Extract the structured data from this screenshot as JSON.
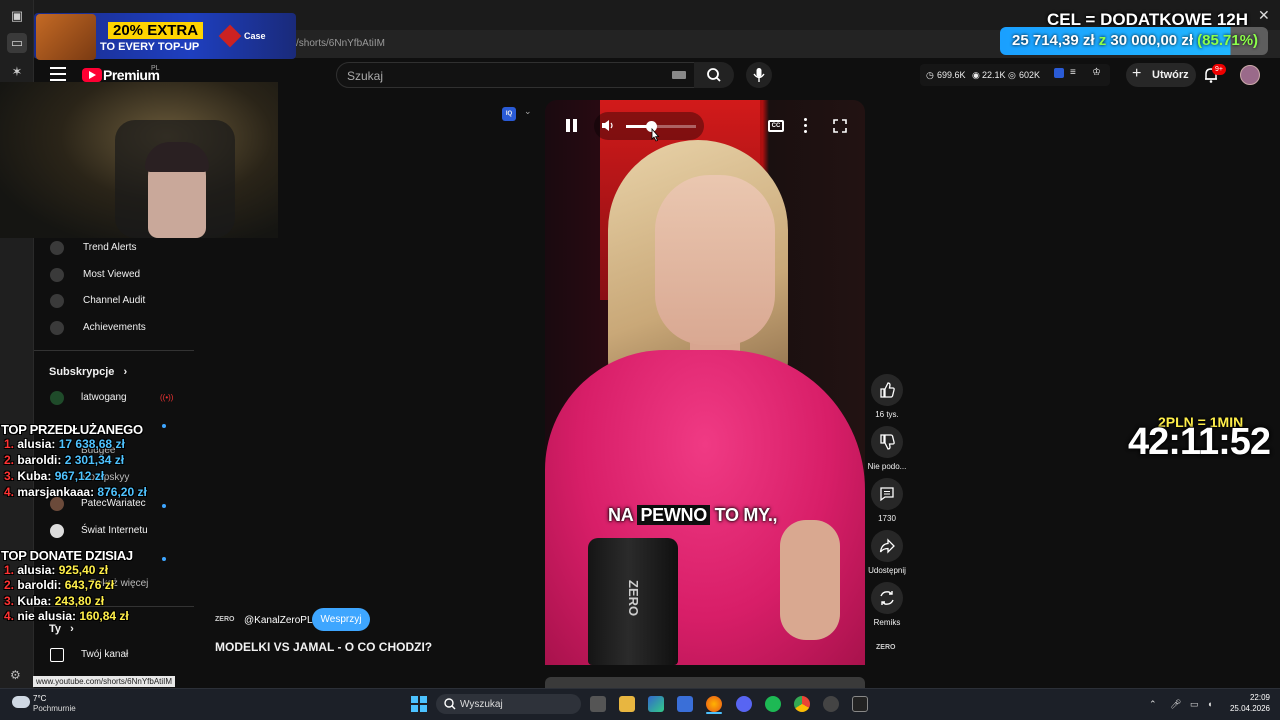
{
  "browser": {
    "url": "/shorts/6NnYfbAtiIM",
    "status_url": "www.youtube.com/shorts/6NnYfbAtiIM"
  },
  "youtube": {
    "brand": "Premium",
    "brand_region": "PL",
    "search_placeholder": "Szukaj",
    "stats": {
      "views": "699.6K",
      "likes": "22.1K",
      "subs": "602K"
    },
    "create_label": "Utwórz",
    "notif_badge": "9+"
  },
  "sidebar": {
    "tools": [
      {
        "label": "Trend Alerts"
      },
      {
        "label": "Most Viewed"
      },
      {
        "label": "Channel Audit"
      },
      {
        "label": "Achievements"
      }
    ],
    "subs_heading": "Subskrypcje",
    "subs_chevron": "›",
    "subscriptions": [
      {
        "label": "latwogang"
      },
      {
        "label": "Budgee"
      },
      {
        "label": "Morbpskyy"
      },
      {
        "label": "PatecWariatec"
      },
      {
        "label": "Świat Internetu"
      },
      {
        "label": "Pokaż więcej"
      }
    ],
    "you_heading": "Ty",
    "you_chevron": "›",
    "your_channel": "Twój kanał"
  },
  "promo": {
    "line1": "20% EXTRA",
    "line2": "TO EVERY TOP-UP",
    "brand": "Case"
  },
  "goal": {
    "title": "CEL = DODATKOWE 12H",
    "current": "25 714,39 zł",
    "sep": "z",
    "target": "30 000,00 zł",
    "percent": "(85.71%)",
    "progress": 0.8571
  },
  "overlay_top_extended": {
    "heading": "TOP PRZEDŁUŻANEGO",
    "entries": [
      {
        "rank": "1.",
        "name": "alusia:",
        "amount": "17 638,68 zł"
      },
      {
        "rank": "2.",
        "name": "baroldi:",
        "amount": "2 301,34 zł"
      },
      {
        "rank": "3.",
        "name": "Kuba:",
        "amount": "967,12 zł"
      },
      {
        "rank": "4.",
        "name": "marsjankaaa:",
        "amount": "876,20 zł"
      }
    ]
  },
  "overlay_top_today": {
    "heading": "TOP DONATE DZISIAJ",
    "entries": [
      {
        "rank": "1.",
        "name": "alusia:",
        "amount": "925,40 zł"
      },
      {
        "rank": "2.",
        "name": "baroldi:",
        "amount": "643,76 zł"
      },
      {
        "rank": "3.",
        "name": "Kuba:",
        "amount": "243,80 zł"
      },
      {
        "rank": "4.",
        "name": "nie alusia:",
        "amount": "160,84 zł"
      }
    ]
  },
  "video": {
    "subtitle_a": "NA",
    "subtitle_b": "PEWNO",
    "subtitle_c": "TO MY.,",
    "cup_logo": "ZERO",
    "cc_label": "CC",
    "volume": 0.35,
    "dock_label": "IQ"
  },
  "actions": {
    "likes": "16 tys.",
    "dislike": "Nie podo...",
    "comments": "1730",
    "share": "Udostępnij",
    "remix": "Remiks",
    "channel_logo": "ZERO"
  },
  "channel": {
    "logo": "ZERO",
    "handle": "@KanalZeroPL",
    "support": "Wesprzyj",
    "title": "MODELKI VS JAMAL - O CO CHODZI?"
  },
  "timer": {
    "rate": "2PLN = 1MIN",
    "time": "42:11:52"
  },
  "taskbar": {
    "temp": "7°C",
    "weather": "Pochmurnie",
    "search": "Wyszukaj",
    "time": "22:09",
    "date": "25.04.2026"
  },
  "colors": {
    "accent": "#3ea6ff",
    "yt_red": "#ff0033",
    "hoodie": "#e0246e",
    "goal_bar": "#20b6ff",
    "goal_percent": "#8cff4a"
  }
}
